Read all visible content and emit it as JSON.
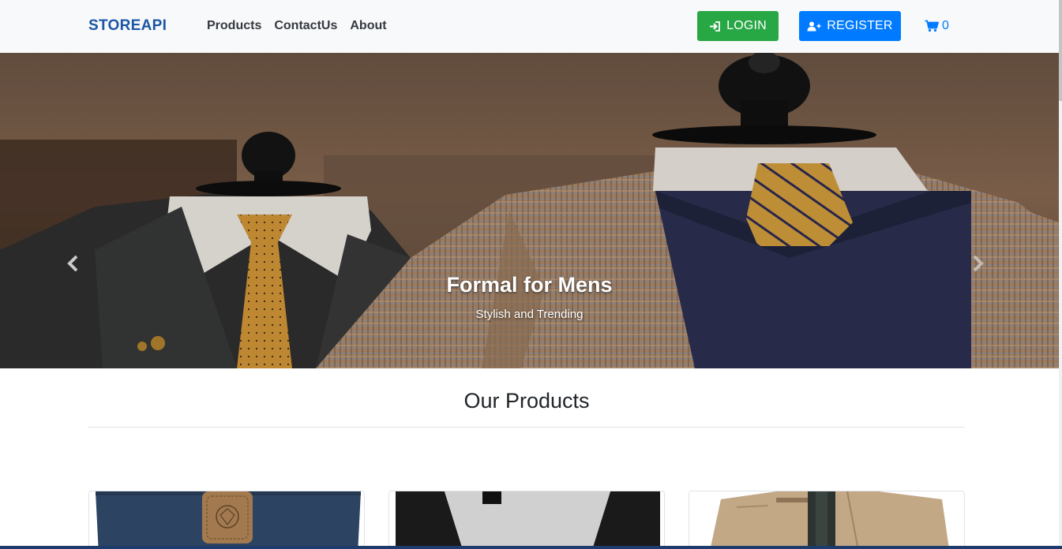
{
  "navbar": {
    "brand": "STOREAPI",
    "links": [
      "Products",
      "ContactUs",
      "About"
    ],
    "login_label": "LOGIN",
    "register_label": "REGISTER",
    "cart_count": "0"
  },
  "hero": {
    "title": "Formal for Mens",
    "subtitle": "Stylish and Trending"
  },
  "products": {
    "section_title": "Our Products",
    "cards": [
      {
        "icon": "sweater-image"
      },
      {
        "icon": "raglan-tee-image"
      },
      {
        "icon": "jacket-image"
      }
    ]
  },
  "colors": {
    "brand": "#1a56a6",
    "login": "#28a745",
    "register": "#007bff",
    "navbar_bg": "#f8f9fa"
  }
}
